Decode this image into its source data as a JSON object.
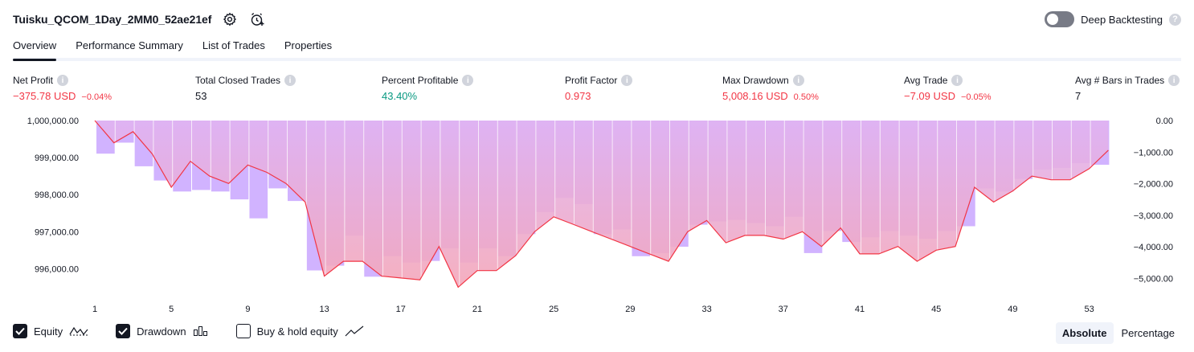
{
  "strategy": {
    "title": "Tuisku_QCOM_1Day_2MM0_52ae21ef"
  },
  "header_icons": [
    "settings-icon",
    "add-alert-icon"
  ],
  "deep_backtesting": {
    "label": "Deep Backtesting",
    "enabled": false
  },
  "tabs": [
    {
      "label": "Overview",
      "active": true
    },
    {
      "label": "Performance Summary",
      "active": false
    },
    {
      "label": "List of Trades",
      "active": false
    },
    {
      "label": "Properties",
      "active": false
    }
  ],
  "metrics": [
    {
      "label": "Net Profit",
      "value": "−375.78 USD",
      "pct": "−0.04%",
      "color": "red"
    },
    {
      "label": "Total Closed Trades",
      "value": "53",
      "pct": "",
      "color": "dark"
    },
    {
      "label": "Percent Profitable",
      "value": "43.40%",
      "pct": "",
      "color": "green"
    },
    {
      "label": "Profit Factor",
      "value": "0.973",
      "pct": "",
      "color": "red"
    },
    {
      "label": "Max Drawdown",
      "value": "5,008.16 USD",
      "pct": "0.50%",
      "color": "red"
    },
    {
      "label": "Avg Trade",
      "value": "−7.09 USD",
      "pct": "−0.05%",
      "color": "red"
    },
    {
      "label": "Avg # Bars in Trades",
      "value": "7",
      "pct": "",
      "color": "dark"
    }
  ],
  "legend": {
    "equity": {
      "label": "Equity",
      "checked": true
    },
    "drawdown": {
      "label": "Drawdown",
      "checked": true
    },
    "buy_hold": {
      "label": "Buy & hold equity",
      "checked": false
    }
  },
  "modes": {
    "absolute": "Absolute",
    "percentage": "Percentage",
    "active": "Absolute"
  },
  "colors": {
    "equity_line": "#f23645",
    "drawdown_bar": "#d1b3ff",
    "fill_top": "#e0b3f2",
    "fill_bottom": "#f4a7b9",
    "loss_fill": "#ffc0c7",
    "text_red": "#f23645",
    "text_green": "#089981"
  },
  "chart_data": {
    "type": "area",
    "x_ticks": [
      "1",
      "5",
      "9",
      "13",
      "17",
      "21",
      "25",
      "29",
      "33",
      "37",
      "41",
      "45",
      "49",
      "53"
    ],
    "y_left_ticks": [
      "1,000,000.00",
      "999,000.00",
      "998,000.00",
      "997,000.00",
      "996,000.00"
    ],
    "y_right_ticks": [
      "0.00",
      "−1,000.00",
      "−2,000.00",
      "−3,000.00",
      "−4,000.00",
      "−5,000.00"
    ],
    "equity_ylim": [
      995400,
      1000000
    ],
    "drawdown_ylim": [
      -5400,
      0
    ],
    "series": [
      {
        "name": "Equity",
        "values": [
          1000000,
          999400,
          999700,
          999100,
          998200,
          998900,
          998500,
          998300,
          998800,
          998600,
          998300,
          997800,
          995800,
          996200,
          996200,
          995800,
          995750,
          995700,
          996600,
          995500,
          995950,
          995950,
          996350,
          997000,
          997400,
          997200,
          997000,
          996800,
          996600,
          996400,
          996200,
          997000,
          997300,
          996700,
          996900,
          996900,
          996800,
          997000,
          996600,
          997100,
          996400,
          996400,
          996600,
          996200,
          996500,
          996600,
          998200,
          997800,
          998100,
          998500,
          998400,
          998400,
          998700,
          999200
        ]
      },
      {
        "name": "Drawdown",
        "values": [
          0,
          -1050,
          -700,
          -1450,
          -1900,
          -2250,
          -2200,
          -2250,
          -2500,
          -3100,
          -2150,
          -2550,
          -4750,
          -4600,
          -3650,
          -4950,
          -4300,
          -4500,
          -4450,
          -4050,
          -4500,
          -4050,
          -4300,
          -3600,
          -2900,
          -2450,
          -2650,
          -3600,
          -3450,
          -4300,
          -4200,
          -4000,
          -3300,
          -3200,
          -3150,
          -3250,
          -3350,
          -3050,
          -4200,
          -3500,
          -3850,
          -3700,
          -3500,
          -3650,
          -3750,
          -3500,
          -3350,
          -2150,
          -2250,
          -1850,
          -1550,
          -1500,
          -1350,
          -1400
        ]
      }
    ]
  }
}
